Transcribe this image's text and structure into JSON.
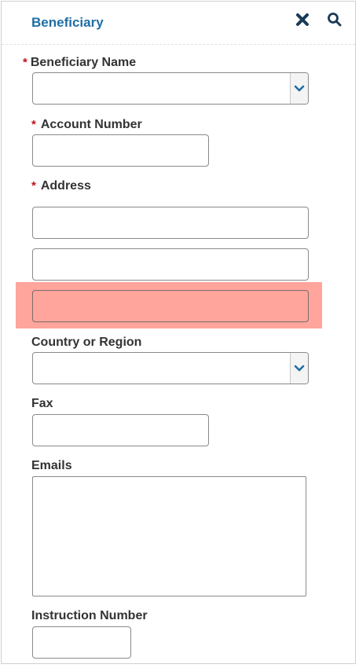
{
  "header": {
    "title": "Beneficiary",
    "close_icon": "close-x-icon",
    "search_icon": "search-icon"
  },
  "form": {
    "required_marker": "*",
    "beneficiary_name_label": "Beneficiary Name",
    "beneficiary_name_value": "",
    "account_number_label": "Account Number",
    "account_number_value": "",
    "address_label": "Address",
    "address_line1_value": "",
    "address_line2_value": "",
    "address_line3_value": "",
    "country_label": "Country or Region",
    "country_value": "",
    "fax_label": "Fax",
    "fax_value": "",
    "emails_label": "Emails",
    "emails_value": "",
    "instruction_number_label": "Instruction Number",
    "instruction_number_value": ""
  },
  "colors": {
    "accent": "#1f6fa4",
    "required": "#c0121b",
    "highlight": "#ffa59c",
    "icon_dark": "#1b3a57"
  }
}
